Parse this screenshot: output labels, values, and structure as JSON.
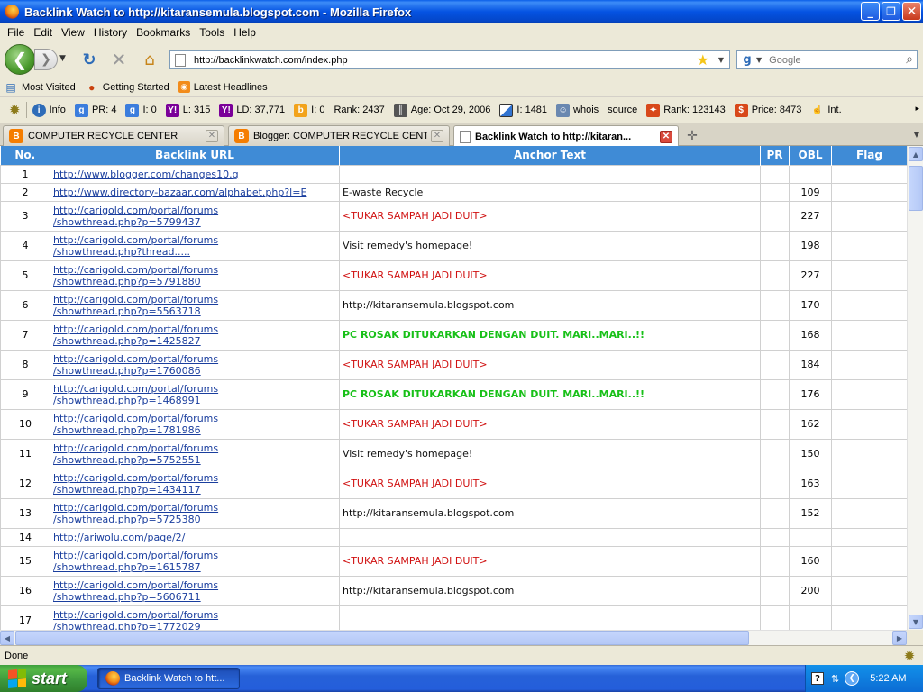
{
  "window": {
    "title": "Backlink Watch to http://kitaransemula.blogspot.com - Mozilla Firefox",
    "minimize": "_",
    "maximize": "❐",
    "close": "✕"
  },
  "menu": [
    "File",
    "Edit",
    "View",
    "History",
    "Bookmarks",
    "Tools",
    "Help"
  ],
  "nav": {
    "url": "http://backlinkwatch.com/index.php",
    "search_placeholder": "Google"
  },
  "bookmarks": [
    "Most Visited",
    "Getting Started",
    "Latest Headlines"
  ],
  "seo_toolbar": [
    {
      "label": "Info",
      "icon": "info-icon"
    },
    {
      "label": "PR: 4",
      "icon": "google-icon"
    },
    {
      "label": "I: 0",
      "icon": "google-icon"
    },
    {
      "label": "L: 315",
      "icon": "yahoo-icon"
    },
    {
      "label": "LD: 37,771",
      "icon": "yahoo-icon"
    },
    {
      "label": "I: 0",
      "icon": "bing-icon"
    },
    {
      "label": "Rank: 2437",
      "icon": ""
    },
    {
      "label": "Age: Oct 29, 2006",
      "icon": "archive-icon"
    },
    {
      "label": "I: 1481",
      "icon": "delicious-icon"
    },
    {
      "label": "whois",
      "icon": "whois-icon"
    },
    {
      "label": "source",
      "icon": ""
    },
    {
      "label": "Rank: 123143",
      "icon": "alexa-icon"
    },
    {
      "label": "Price: 8473",
      "icon": "price-icon"
    },
    {
      "label": "Int.",
      "icon": "hand-icon"
    }
  ],
  "tabs": [
    {
      "label": "COMPUTER RECYCLE CENTER",
      "icon": "blogger-icon",
      "active": false
    },
    {
      "label": "Blogger: COMPUTER RECYCLE CENTER...",
      "icon": "blogger-icon",
      "active": false
    },
    {
      "label": "Backlink Watch to http://kitaran...",
      "icon": "page-icon",
      "active": true
    }
  ],
  "table": {
    "headers": {
      "no": "No.",
      "url": "Backlink URL",
      "anchor": "Anchor Text",
      "pr": "PR",
      "obl": "OBL",
      "flag": "Flag"
    },
    "rows": [
      {
        "no": "1",
        "url1": "http://www.blogger.com/changes10.g",
        "url2": "",
        "anchor": "",
        "style": "black",
        "obl": ""
      },
      {
        "no": "2",
        "url1": "http://www.directory-bazaar.com/alphabet.php?l=E",
        "url2": "",
        "anchor": "E-waste Recycle",
        "style": "black",
        "obl": "109"
      },
      {
        "no": "3",
        "url1": "http://carigold.com/portal/forums",
        "url2": "/showthread.php?p=5799437",
        "anchor": "<TUKAR SAMPAH JADI DUIT>",
        "style": "red",
        "obl": "227"
      },
      {
        "no": "4",
        "url1": "http://carigold.com/portal/forums",
        "url2": "/showthread.php?thread.....",
        "anchor": "Visit remedy's homepage!",
        "style": "black",
        "obl": "198"
      },
      {
        "no": "5",
        "url1": "http://carigold.com/portal/forums",
        "url2": "/showthread.php?p=5791880",
        "anchor": "<TUKAR SAMPAH JADI DUIT>",
        "style": "red",
        "obl": "227"
      },
      {
        "no": "6",
        "url1": "http://carigold.com/portal/forums",
        "url2": "/showthread.php?p=5563718",
        "anchor": "http://kitaransemula.blogspot.com",
        "style": "black",
        "obl": "170"
      },
      {
        "no": "7",
        "url1": "http://carigold.com/portal/forums",
        "url2": "/showthread.php?p=1425827",
        "anchor": "PC ROSAK DITUKARKAN DENGAN DUIT. MARI..MARI..!!",
        "style": "green",
        "obl": "168"
      },
      {
        "no": "8",
        "url1": "http://carigold.com/portal/forums",
        "url2": "/showthread.php?p=1760086",
        "anchor": "<TUKAR SAMPAH JADI DUIT>",
        "style": "red",
        "obl": "184"
      },
      {
        "no": "9",
        "url1": "http://carigold.com/portal/forums",
        "url2": "/showthread.php?p=1468991",
        "anchor": "PC ROSAK DITUKARKAN DENGAN DUIT. MARI..MARI..!!",
        "style": "green",
        "obl": "176"
      },
      {
        "no": "10",
        "url1": "http://carigold.com/portal/forums",
        "url2": "/showthread.php?p=1781986",
        "anchor": "<TUKAR SAMPAH JADI DUIT>",
        "style": "red",
        "obl": "162"
      },
      {
        "no": "11",
        "url1": "http://carigold.com/portal/forums",
        "url2": "/showthread.php?p=5752551",
        "anchor": "Visit remedy's homepage!",
        "style": "black",
        "obl": "150"
      },
      {
        "no": "12",
        "url1": "http://carigold.com/portal/forums",
        "url2": "/showthread.php?p=1434117",
        "anchor": "<TUKAR SAMPAH JADI DUIT>",
        "style": "red",
        "obl": "163"
      },
      {
        "no": "13",
        "url1": "http://carigold.com/portal/forums",
        "url2": "/showthread.php?p=5725380",
        "anchor": "http://kitaransemula.blogspot.com",
        "style": "black",
        "obl": "152"
      },
      {
        "no": "14",
        "url1": "http://ariwolu.com/page/2/",
        "url2": "",
        "anchor": "",
        "style": "black",
        "obl": ""
      },
      {
        "no": "15",
        "url1": "http://carigold.com/portal/forums",
        "url2": "/showthread.php?p=1615787",
        "anchor": "<TUKAR SAMPAH JADI DUIT>",
        "style": "red",
        "obl": "160"
      },
      {
        "no": "16",
        "url1": "http://carigold.com/portal/forums",
        "url2": "/showthread.php?p=5606711",
        "anchor": "http://kitaransemula.blogspot.com",
        "style": "black",
        "obl": "200"
      },
      {
        "no": "17",
        "url1": "http://carigold.com/portal/forums",
        "url2": "/showthread.php?p=1772029",
        "anchor": "",
        "style": "black",
        "obl": ""
      }
    ]
  },
  "status": "Done",
  "taskbar": {
    "start": "start",
    "item": "Backlink Watch to htt...",
    "clock": "5:22 AM"
  }
}
